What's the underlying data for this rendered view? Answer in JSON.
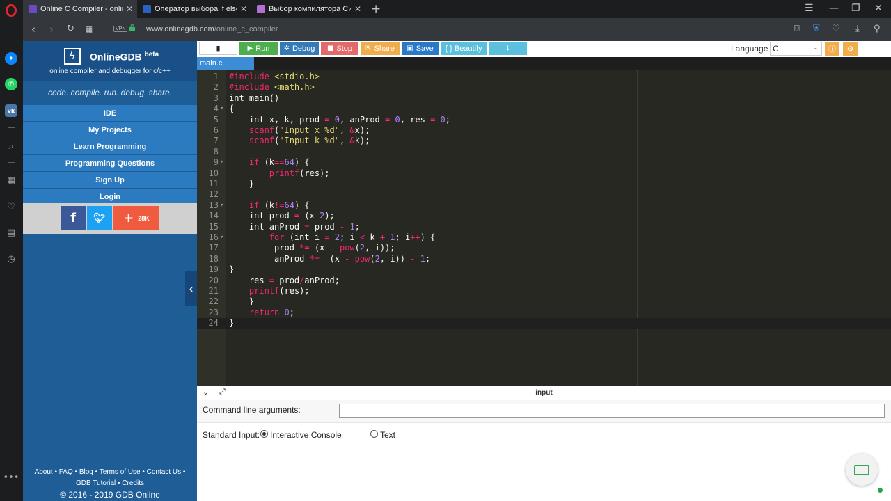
{
  "browser": {
    "tabs": [
      {
        "title": "Online C Compiler - online",
        "favicon_color": "#6a4bc4"
      },
      {
        "title": "Оператор выбора if else в",
        "favicon_color": "#2b62c0"
      },
      {
        "title": "Выбор компилятора Си",
        "favicon_color": "#b36fd1"
      }
    ],
    "url": {
      "host": "www.onlinegdb.com",
      "path": "/online_c_compiler"
    },
    "vpn_label": "VPN"
  },
  "sidebar": {
    "brand": "OnlineGDB",
    "brand_sup": "beta",
    "brand_sub": "online compiler and debugger for c/c++",
    "tagline": "code. compile. run. debug. share.",
    "nav": [
      "IDE",
      "My Projects",
      "Learn Programming",
      "Programming Questions",
      "Sign Up",
      "Login"
    ],
    "share_count": "28K",
    "footer_links_1": "About • FAQ • Blog • Terms of Use • Contact Us •",
    "footer_links_2": "GDB Tutorial • Credits",
    "copyright": "© 2016 - 2019 GDB Online"
  },
  "toolbar": {
    "run": "Run",
    "debug": "Debug",
    "stop": "Stop",
    "share": "Share",
    "save": "Save",
    "beautify": "{ } Beautify",
    "language_label": "Language",
    "language_value": "C"
  },
  "colors": {
    "run": "#4cae4c",
    "debug": "#337ab7",
    "stop": "#e26a6a",
    "share": "#f0ad4e",
    "save": "#2a78c8",
    "beautify": "#5bc0de",
    "download": "#5bc0de"
  },
  "editor": {
    "file_tab": "main.c",
    "lines": [
      "#include <stdio.h>",
      "#include <math.h>",
      "int main()",
      "{",
      "    int x, k, prod = 0, anProd = 0, res = 0;",
      "    scanf(\"Input x %d\", &x);",
      "    scanf(\"Input k %d\", &k);",
      "",
      "    if (k==64) {",
      "        printf(res);",
      "    }",
      "",
      "    if (k!=64) {",
      "    int prod = (x-2);",
      "    int anProd = prod - 1;",
      "        for (int i = 2; i < k + 1; i++) {",
      "         prod *= (x - pow(2, i));",
      "         anProd *=  (x - pow(2, i)) - 1;",
      "}",
      "    res = prod/anProd;",
      "    printf(res);",
      "    }",
      "    return 0;",
      "}"
    ]
  },
  "io": {
    "title": "input",
    "cla_label": "Command line arguments:",
    "stdin_label": "Standard Input:",
    "opt_console": "Interactive Console",
    "opt_text": "Text"
  }
}
